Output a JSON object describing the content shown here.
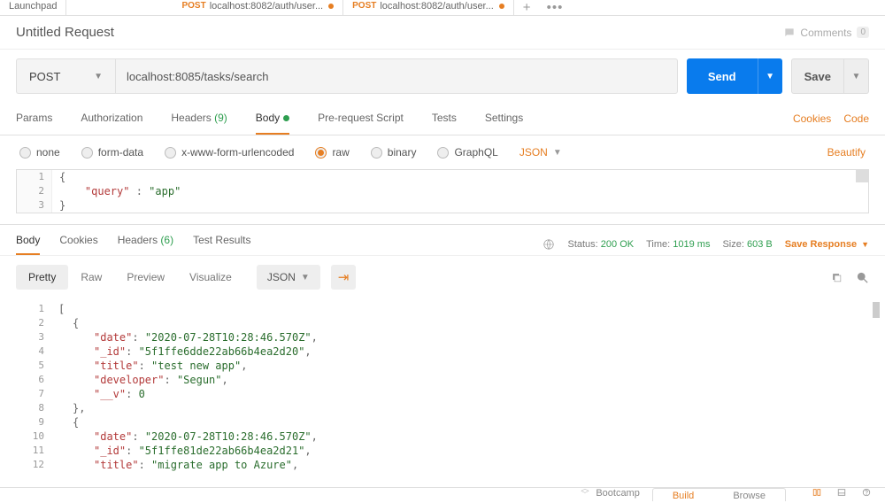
{
  "tabs": {
    "launchpad": "Launchpad",
    "t1_method": "POST",
    "t1_text": "localhost:8082/auth/user...",
    "t2_method": "POST",
    "t2_text": "localhost:8082/auth/user..."
  },
  "title": "Untitled Request",
  "comments": {
    "label": "Comments",
    "count": "0"
  },
  "method": "POST",
  "url": "localhost:8085/tasks/search",
  "send": "Send",
  "save": "Save",
  "req_tabs": {
    "params": "Params",
    "auth": "Authorization",
    "headers": "Headers",
    "headers_count": "(9)",
    "body": "Body",
    "prs": "Pre-request Script",
    "tests": "Tests",
    "settings": "Settings",
    "cookies": "Cookies",
    "code": "Code"
  },
  "body_types": {
    "none": "none",
    "form": "form-data",
    "xwww": "x-www-form-urlencoded",
    "raw": "raw",
    "binary": "binary",
    "graphql": "GraphQL",
    "json": "JSON",
    "beautify": "Beautify"
  },
  "req_body": {
    "ln1": "{",
    "ln2_key": "\"query\"",
    "ln2_sep": " : ",
    "ln2_val": "\"app\"",
    "ln3": "}"
  },
  "resp_tabs": {
    "body": "Body",
    "cookies": "Cookies",
    "headers": "Headers",
    "headers_count": "(6)",
    "test": "Test Results"
  },
  "resp_meta": {
    "status_lbl": "Status:",
    "status_val": "200 OK",
    "time_lbl": "Time:",
    "time_val": "1019 ms",
    "size_lbl": "Size:",
    "size_val": "603 B",
    "save": "Save Response"
  },
  "view": {
    "pretty": "Pretty",
    "raw": "Raw",
    "preview": "Preview",
    "visualize": "Visualize",
    "json": "JSON"
  },
  "resp_body": {
    "l1": "[",
    "l2": "{",
    "l3_k": "\"date\"",
    "l3_v": "\"2020-07-28T10:28:46.570Z\"",
    "l4_k": "\"_id\"",
    "l4_v": "\"5f1ffe6dde22ab66b4ea2d20\"",
    "l5_k": "\"title\"",
    "l5_v": "\"test new app\"",
    "l6_k": "\"developer\"",
    "l6_v": "\"Segun\"",
    "l7_k": "\"__v\"",
    "l7_v": "0",
    "l8": "},",
    "l9": "{",
    "l10_k": "\"date\"",
    "l10_v": "\"2020-07-28T10:28:46.570Z\"",
    "l11_k": "\"_id\"",
    "l11_v": "\"5f1ffe81de22ab66b4ea2d21\"",
    "l12_k": "\"title\"",
    "l12_v": "\"migrate app to Azure\""
  },
  "footer": {
    "bootcamp": "Bootcamp",
    "build": "Build",
    "browse": "Browse"
  }
}
